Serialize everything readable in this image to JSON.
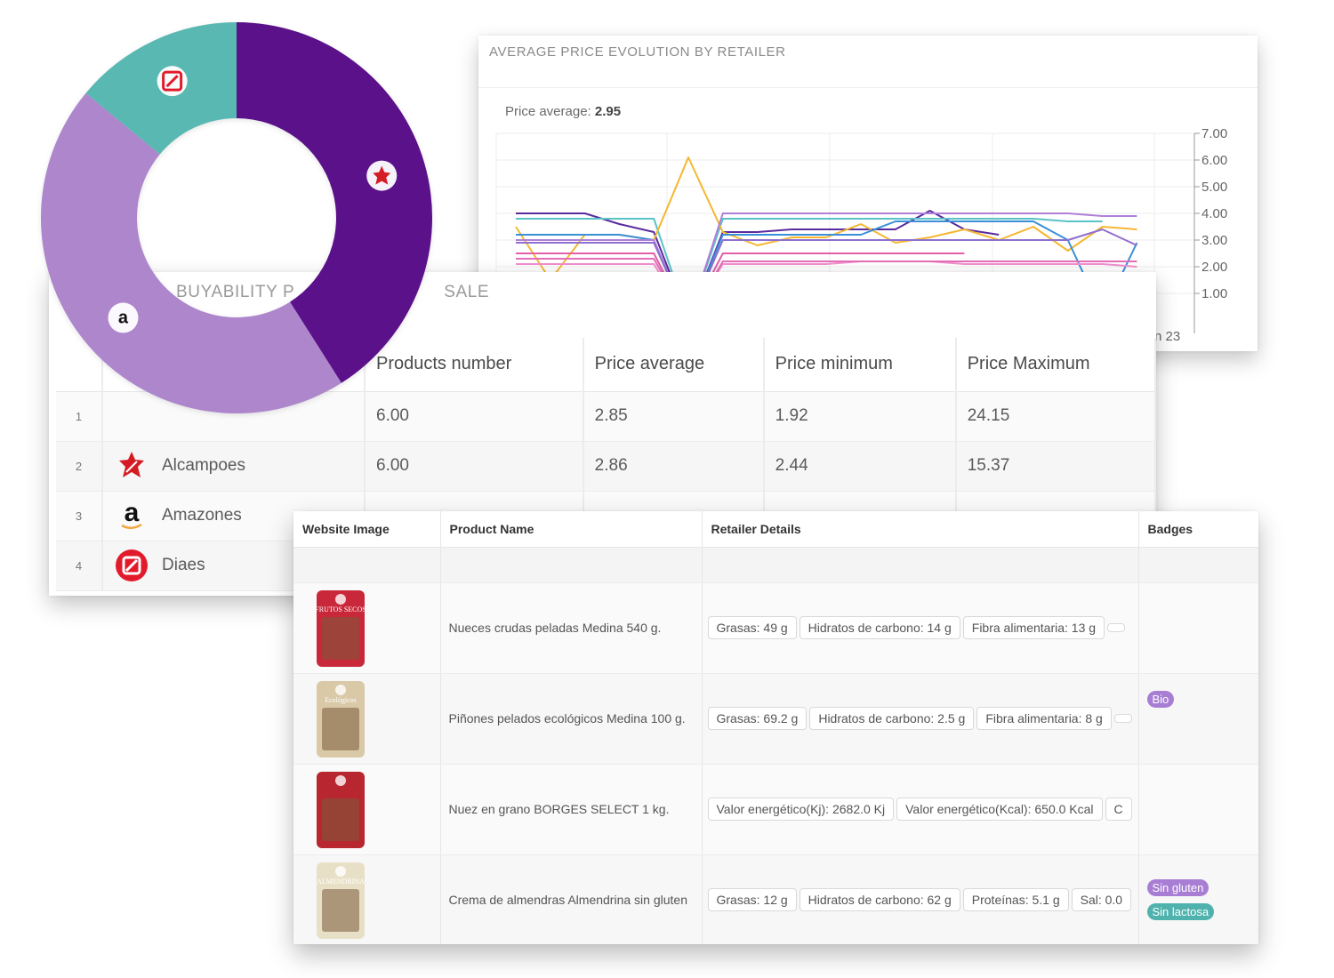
{
  "price_card": {
    "title": "AVERAGE PRICE EVOLUTION BY RETAILER",
    "avg_label": "Price average:",
    "avg_value": "2.95",
    "date_label": "n 23"
  },
  "chart_data": {
    "type": "line",
    "ylim": [
      0,
      7
    ],
    "y_ticks": [
      "7.00",
      "6.00",
      "5.00",
      "4.00",
      "3.00",
      "2.00",
      "1.00"
    ],
    "grid": true,
    "series": [
      {
        "color": "#5b2a9e",
        "values": [
          4.0,
          4.0,
          4.0,
          3.6,
          3.3,
          0.0,
          3.3,
          3.3,
          3.4,
          3.4,
          3.4,
          3.4,
          4.1,
          3.4,
          3.2
        ]
      },
      {
        "color": "#5bc2c6",
        "values": [
          3.8,
          3.8,
          3.8,
          3.8,
          3.8,
          0.0,
          3.8,
          3.8,
          3.8,
          3.8,
          3.8,
          3.8,
          3.8,
          3.8,
          3.8,
          3.8,
          3.7,
          3.7
        ]
      },
      {
        "color": "#f5b731",
        "values": [
          3.5,
          1.5,
          3.2,
          3.2,
          3.0,
          6.1,
          3.3,
          2.8,
          3.1,
          3.1,
          3.6,
          2.9,
          3.1,
          3.4,
          3.0,
          3.5,
          2.6,
          3.5,
          3.4
        ]
      },
      {
        "color": "#3a8fd8",
        "values": [
          3.2,
          3.2,
          3.2,
          3.2,
          3.0,
          0.0,
          3.2,
          3.2,
          3.2,
          3.2,
          3.2,
          3.7,
          3.7,
          3.7,
          3.7,
          3.7,
          3.0,
          0.2,
          2.9
        ]
      },
      {
        "color": "#b07fd8",
        "values": [
          3.0,
          3.0,
          3.0,
          3.0,
          3.0,
          0.0,
          4.0,
          4.0,
          4.0,
          4.0,
          4.0,
          4.0,
          4.0,
          4.0,
          4.0,
          4.0,
          4.0,
          3.9,
          3.9
        ]
      },
      {
        "color": "#8f6fd0",
        "values": [
          2.9,
          2.9,
          2.9,
          2.9,
          2.9,
          0.0,
          3.0,
          3.0,
          3.0,
          3.0,
          3.0,
          3.0,
          3.0,
          3.0,
          3.0,
          3.0,
          3.0,
          3.4,
          2.8
        ]
      },
      {
        "color": "#e05fa8",
        "values": [
          2.5,
          2.5,
          2.5,
          2.5,
          2.5,
          0.0,
          2.5,
          2.5,
          2.5,
          2.5,
          2.5,
          2.5,
          2.5,
          2.5
        ]
      },
      {
        "color": "#f28fd0",
        "values": [
          2.1,
          2.1,
          2.1,
          2.1,
          2.1,
          0.0,
          2.1,
          2.1,
          2.1,
          2.1,
          2.2,
          2.2,
          2.2,
          2.1,
          2.1,
          2.1,
          2.1,
          2.1,
          2.0
        ]
      },
      {
        "color": "#e56fb8",
        "values": [
          2.3,
          2.3,
          2.3,
          2.3,
          2.3,
          0.0,
          2.2,
          2.2,
          2.2,
          2.2,
          2.2,
          2.2,
          2.2,
          2.2,
          2.2,
          2.2,
          2.2,
          2.2,
          2.2
        ]
      }
    ]
  },
  "buy_card": {
    "title": "BUYABILITY P",
    "title_tail": "SALE",
    "headers": [
      "",
      "",
      "Products number",
      "Price average",
      "Price minimum",
      "Price Maximum"
    ],
    "rows": [
      {
        "idx": "1",
        "retailer": "",
        "logo": "none",
        "products": "6.00",
        "avg": "2.85",
        "min": "1.92",
        "max": "24.15"
      },
      {
        "idx": "2",
        "retailer": "Alcampoes",
        "logo": "alcampo-icon",
        "products": "6.00",
        "avg": "2.86",
        "min": "2.44",
        "max": "15.37"
      },
      {
        "idx": "3",
        "retailer": "Amazones",
        "logo": "amazon-icon",
        "products": "",
        "avg": "",
        "min": "",
        "max": ""
      },
      {
        "idx": "4",
        "retailer": "Diaes",
        "logo": "dia-icon",
        "products": "",
        "avg": "",
        "min": "",
        "max": ""
      }
    ]
  },
  "donut": {
    "slices": [
      {
        "retailer": "Alcampo",
        "share": 0.41,
        "color": "#5b1189",
        "icon": "alcampo-icon"
      },
      {
        "retailer": "Amazon",
        "share": 0.45,
        "color": "#ad86cc",
        "icon": "amazon-icon"
      },
      {
        "retailer": "Dia",
        "share": 0.14,
        "color": "#5ab8b3",
        "icon": "dia-icon"
      }
    ]
  },
  "product_table": {
    "headers": [
      "Website Image",
      "Product Name",
      "Retailer Details",
      "Badges"
    ],
    "rows": [
      {
        "name": "Nueces crudas peladas Medina 540 g.",
        "details": [
          "Grasas: 49 g",
          "Hidratos de carbono: 14 g",
          "Fibra alimentaria: 13 g",
          ""
        ],
        "badges": [],
        "img_text": "FRUTOS SECOS",
        "img_color": "#c9283a"
      },
      {
        "name": "Piñones pelados ecológicos Medina 100 g.",
        "details": [
          "Grasas: 69.2 g",
          "Hidratos de carbono: 2.5 g",
          "Fibra alimentaria: 8 g",
          ""
        ],
        "badges": [
          {
            "label": "Bio",
            "color": "#a87ed4"
          }
        ],
        "img_text": "Ecológicos",
        "img_color": "#d9c9a7"
      },
      {
        "name": "Nuez en grano BORGES SELECT 1 kg.",
        "details": [
          "Valor energético(Kj): 2682.0 Kj",
          "Valor energético(Kcal): 650.0 Kcal",
          "C"
        ],
        "badges": [],
        "img_text": "",
        "img_color": "#b8262f"
      },
      {
        "name": "Crema de almendras Almendrina sin gluten",
        "details": [
          "Grasas: 12 g",
          "Hidratos de carbono: 62 g",
          "Proteínas: 5.1 g",
          "Sal: 0.0"
        ],
        "badges": [
          {
            "label": "Sin gluten",
            "color": "#a87ed4"
          },
          {
            "label": "Sin lactosa",
            "color": "#4fb2ac"
          }
        ],
        "img_text": "ALMENDRINA",
        "img_color": "#e7e0c6"
      }
    ]
  },
  "colors": {
    "accent_purple": "#5b1189",
    "light_purple": "#ad86cc",
    "teal": "#5ab8b3"
  }
}
